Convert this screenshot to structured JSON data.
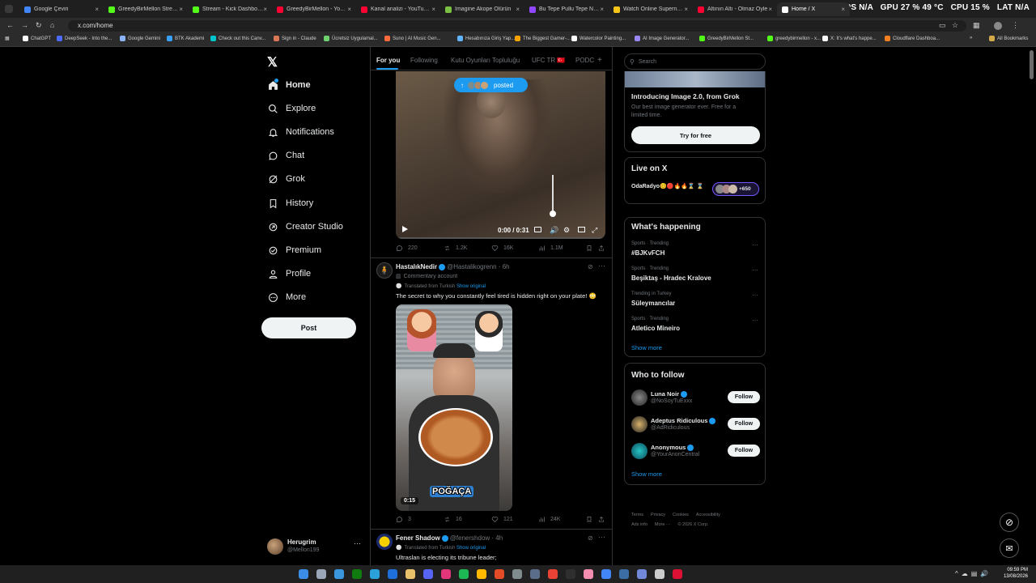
{
  "browser": {
    "tabs": [
      {
        "label": "Google Çeviri",
        "color": "#4285f4"
      },
      {
        "label": "GreedyBirMellon Stream",
        "color": "#53fc18"
      },
      {
        "label": "Stream - Kick Dashboard",
        "color": "#53fc18"
      },
      {
        "label": "GreedyBirMellon - YouTub",
        "color": "#ff0033"
      },
      {
        "label": "Kanal analizi - YouTube St",
        "color": "#ff0033"
      },
      {
        "label": "Imagine Akope Ölürün",
        "color": "#7ac143"
      },
      {
        "label": "Bu Tepe Pullu Tepe Notal",
        "color": "#9146ff"
      },
      {
        "label": "Watch Online Supernatur",
        "color": "#f5c518"
      },
      {
        "label": "Altının Altı - Olmaz Öyle",
        "color": "#ff0033"
      },
      {
        "label": "Home / X",
        "color": "#ffffff"
      }
    ],
    "hud": {
      "fps": "FPS N/A",
      "gpu": "GPU 27 % 49 °C",
      "cpu": "CPU 15 %",
      "lat": "LAT N/A"
    },
    "url": "x.com/home",
    "bookmarks": [
      {
        "label": "ChatGPT",
        "color": "#ffffff"
      },
      {
        "label": "DeepSeek - Into the...",
        "color": "#4d6bfe"
      },
      {
        "label": "Google Gemini",
        "color": "#8ab4f8"
      },
      {
        "label": "BTK Akademi",
        "color": "#3aa0ff"
      },
      {
        "label": "Check out this Canv...",
        "color": "#00c4cc"
      },
      {
        "label": "Sign in - Claude",
        "color": "#d97757"
      },
      {
        "label": "Ücretsiz Uygulamal...",
        "color": "#6ed36e"
      },
      {
        "label": "Suno | AI Music Gen...",
        "color": "#ff6a3d"
      },
      {
        "label": "Hesabınıza Giriş Yap...",
        "color": "#5fb3ff"
      },
      {
        "label": "The Biggest Gamer-...",
        "color": "#f4a300"
      },
      {
        "label": "Watercolor Painting...",
        "color": "#ffffff"
      },
      {
        "label": "AI Image Generator...",
        "color": "#9b87f5"
      },
      {
        "label": "GreedyBirMellon St...",
        "color": "#53fc18"
      },
      {
        "label": "greedybirmellon - x...",
        "color": "#53fc18"
      },
      {
        "label": "X: It's what's happe...",
        "color": "#ffffff"
      },
      {
        "label": "Cloudflare Dashboa...",
        "color": "#f38020"
      }
    ],
    "all_bookmarks": "All Bookmarks"
  },
  "nav": {
    "items": [
      {
        "label": "Home",
        "icon": "home-icon"
      },
      {
        "label": "Explore",
        "icon": "search-icon"
      },
      {
        "label": "Notifications",
        "icon": "bell-icon"
      },
      {
        "label": "Chat",
        "icon": "chat-icon"
      },
      {
        "label": "Grok",
        "icon": "grok-icon"
      },
      {
        "label": "History",
        "icon": "bookmark-icon"
      },
      {
        "label": "Creator Studio",
        "icon": "creator-icon"
      },
      {
        "label": "Premium",
        "icon": "premium-icon"
      },
      {
        "label": "Profile",
        "icon": "person-icon"
      },
      {
        "label": "More",
        "icon": "more-icon"
      }
    ],
    "post_label": "Post",
    "account": {
      "name": "Herugrim",
      "handle": "@Mellon199"
    }
  },
  "feed": {
    "tabs": [
      "For you",
      "Following",
      "Kutu Oyunları Topluluğu",
      "UFC TR 🇹🇷",
      "PODC"
    ],
    "posted_label": "posted",
    "video_time": "0:00 / 0:31",
    "post1_stats": {
      "replies": "220",
      "reposts": "1.2K",
      "likes": "16K",
      "views": "1.1M"
    },
    "post2": {
      "name": "HastalıkNedir",
      "handle": "@Hastalikogrenn · 6h",
      "label": "Commentary account",
      "translated": "Translated from Turkish",
      "show_original": "Show original",
      "text": "The secret to why you constantly feel tired is hidden right on your plate! 😳",
      "video_caption": "POĞAÇA",
      "duration": "0:15",
      "stats": {
        "replies": "3",
        "reposts": "16",
        "likes": "121",
        "views": "24K"
      }
    },
    "post3": {
      "name": "Fener Shadow",
      "handle": "@fenershdow · 4h",
      "translated": "Translated from Turkish",
      "show_original": "Show original",
      "text": "Ultraslan is electing its tribune leader;"
    }
  },
  "right": {
    "search_placeholder": "Search",
    "grok_card": {
      "title": "Introducing Image 2.0, from Grok",
      "desc": "Our best image generator ever. Free for a limited time.",
      "button": "Try for free"
    },
    "live": {
      "title": "Live on X",
      "host": "OdaRadyo😊🔴🔥🔥⌛ ⌛",
      "count": "+650"
    },
    "happening": {
      "title": "What's happening",
      "trends": [
        {
          "meta": "Sports · Trending",
          "name": "#BJKvFCH"
        },
        {
          "meta": "Sports · Trending",
          "name": "Beşiktaş - Hradec Kralove"
        },
        {
          "meta": "Trending in Turkey",
          "name": "Süleymancılar"
        },
        {
          "meta": "Sports · Trending",
          "name": "Atletico Mineiro"
        }
      ],
      "show_more": "Show more"
    },
    "who_to_follow": {
      "title": "Who to follow",
      "users": [
        {
          "name": "Luna Noir",
          "handle": "@NoSoyTuExxx"
        },
        {
          "name": "Adeptus Ridiculous",
          "handle": "@AdRidiculous"
        },
        {
          "name": "Anonymous",
          "handle": "@YourAnonCentral"
        }
      ],
      "follow_label": "Follow",
      "show_more": "Show more"
    },
    "footer": {
      "line1": [
        "Terms",
        "Privacy",
        "Cookies",
        "Accessibility"
      ],
      "line2": [
        "Ads info",
        "More ···",
        "© 2026 X Corp."
      ]
    }
  },
  "taskbar": {
    "time": "09:59 PM",
    "date": "13/08/2026"
  }
}
